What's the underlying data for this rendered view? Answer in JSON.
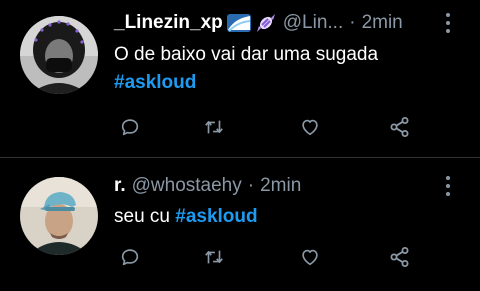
{
  "theme": {
    "background": "#000000",
    "text": "#ffffff",
    "muted": "#8b98a5",
    "accent": "#1d9bf0",
    "divider": "#2f3336"
  },
  "tweets": [
    {
      "name": "_Linezin_xp",
      "emojis": [
        "wave-emoji",
        "candy-emoji"
      ],
      "handle": "@Lin...",
      "separator": "·",
      "time": "2min",
      "text": "O de baixo vai dar uma sugada",
      "hashtag": "#askloud",
      "actions": [
        "reply-icon",
        "retweet-icon",
        "like-icon",
        "share-icon"
      ]
    },
    {
      "name": "r.",
      "handle": "@whostaehy",
      "separator": "·",
      "time": "2min",
      "text": "seu cu",
      "hashtag": "#askloud",
      "actions": [
        "reply-icon",
        "retweet-icon",
        "like-icon",
        "share-icon"
      ]
    }
  ]
}
